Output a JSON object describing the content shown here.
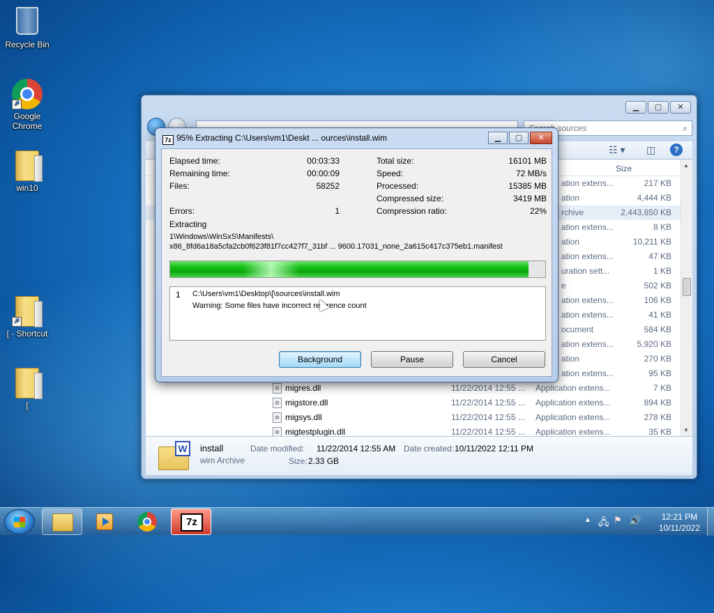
{
  "desktop": {
    "icons": [
      {
        "label": "Recycle Bin"
      },
      {
        "label": "Google Chrome"
      },
      {
        "label": "win10"
      },
      {
        "label": "[ - Shortcut"
      },
      {
        "label": "["
      }
    ]
  },
  "explorer": {
    "search_placeholder": "Search sources",
    "column_size": "Size",
    "rows": [
      {
        "name": "",
        "date": "",
        "type": "ation extens...",
        "size": "217 KB"
      },
      {
        "name": "",
        "date": "",
        "type": "ation",
        "size": "4,444 KB"
      },
      {
        "name": "",
        "date": "",
        "type": "rchive",
        "size": "2,443,850 KB"
      },
      {
        "name": "",
        "date": "",
        "type": "ation extens...",
        "size": "8 KB"
      },
      {
        "name": "",
        "date": "",
        "type": "ation",
        "size": "10,211 KB"
      },
      {
        "name": "",
        "date": "",
        "type": "ation extens...",
        "size": "47 KB"
      },
      {
        "name": "",
        "date": "",
        "type": "uration sett...",
        "size": "1 KB"
      },
      {
        "name": "",
        "date": "",
        "type": "e",
        "size": "502 KB"
      },
      {
        "name": "",
        "date": "",
        "type": "ation extens...",
        "size": "106 KB"
      },
      {
        "name": "",
        "date": "",
        "type": "ation extens...",
        "size": "41 KB"
      },
      {
        "name": "",
        "date": "",
        "type": "ocument",
        "size": "584 KB"
      },
      {
        "name": "",
        "date": "",
        "type": "ation extens...",
        "size": "5,920 KB"
      },
      {
        "name": "",
        "date": "",
        "type": "ation",
        "size": "270 KB"
      },
      {
        "name": "",
        "date": "",
        "type": "ation extens...",
        "size": "95 KB"
      },
      {
        "name": "migres.dll",
        "date": "11/22/2014 12:55 ...",
        "type": "Application extens...",
        "size": "7 KB"
      },
      {
        "name": "migstore.dll",
        "date": "11/22/2014 12:55 ...",
        "type": "Application extens...",
        "size": "894 KB"
      },
      {
        "name": "migsys.dll",
        "date": "11/22/2014 12:55 ...",
        "type": "Application extens...",
        "size": "278 KB"
      },
      {
        "name": "migtestplugin.dll",
        "date": "11/22/2014 12:55 ...",
        "type": "Application extens...",
        "size": "35 KB"
      }
    ],
    "details": {
      "name": "install",
      "type": "wim Archive",
      "modified_label": "Date modified:",
      "modified_value": "11/22/2014 12:55 AM",
      "created_label": "Date created:",
      "created_value": "10/11/2022 12:11 PM",
      "size_label": "Size:",
      "size_value": "2.33 GB"
    }
  },
  "dialog": {
    "title": "95% Extracting C:\\Users\\vm1\\Deskt ... ources\\install.wim",
    "app_icon": "7z",
    "elapsed_label": "Elapsed time:",
    "elapsed_value": "00:03:33",
    "remaining_label": "Remaining time:",
    "remaining_value": "00:00:09",
    "files_label": "Files:",
    "files_value": "58252",
    "errors_label": "Errors:",
    "errors_value": "1",
    "total_label": "Total size:",
    "total_value": "16101 MB",
    "speed_label": "Speed:",
    "speed_value": "72 MB/s",
    "processed_label": "Processed:",
    "processed_value": "15385 MB",
    "compressed_label": "Compressed size:",
    "compressed_value": "3419 MB",
    "ratio_label": "Compression ratio:",
    "ratio_value": "22%",
    "extracting_label": "Extracting",
    "path_line1": "1\\Windows\\WinSxS\\Manifests\\",
    "path_line2": "x86_8fd6a18a5cfa2cb0f623f81f7cc427f7_31bf ... 9600.17031_none_2a615c417c375eb1.manifest",
    "progress_fraction": 0.955,
    "log_index": "1",
    "log_path": "C:\\Users\\vm1\\Desktop\\[\\sources\\install.wim",
    "log_warning": "Warning: Some files have incorrect reference count",
    "background_btn": "Background",
    "pause_btn": "Pause",
    "cancel_btn": "Cancel"
  },
  "taskbar": {
    "time": "12:21 PM",
    "date": "10/11/2022"
  },
  "colors": {
    "progress_green": "#16c016",
    "titlebar": "#c9dcf2",
    "close_red": "#c8442a"
  }
}
